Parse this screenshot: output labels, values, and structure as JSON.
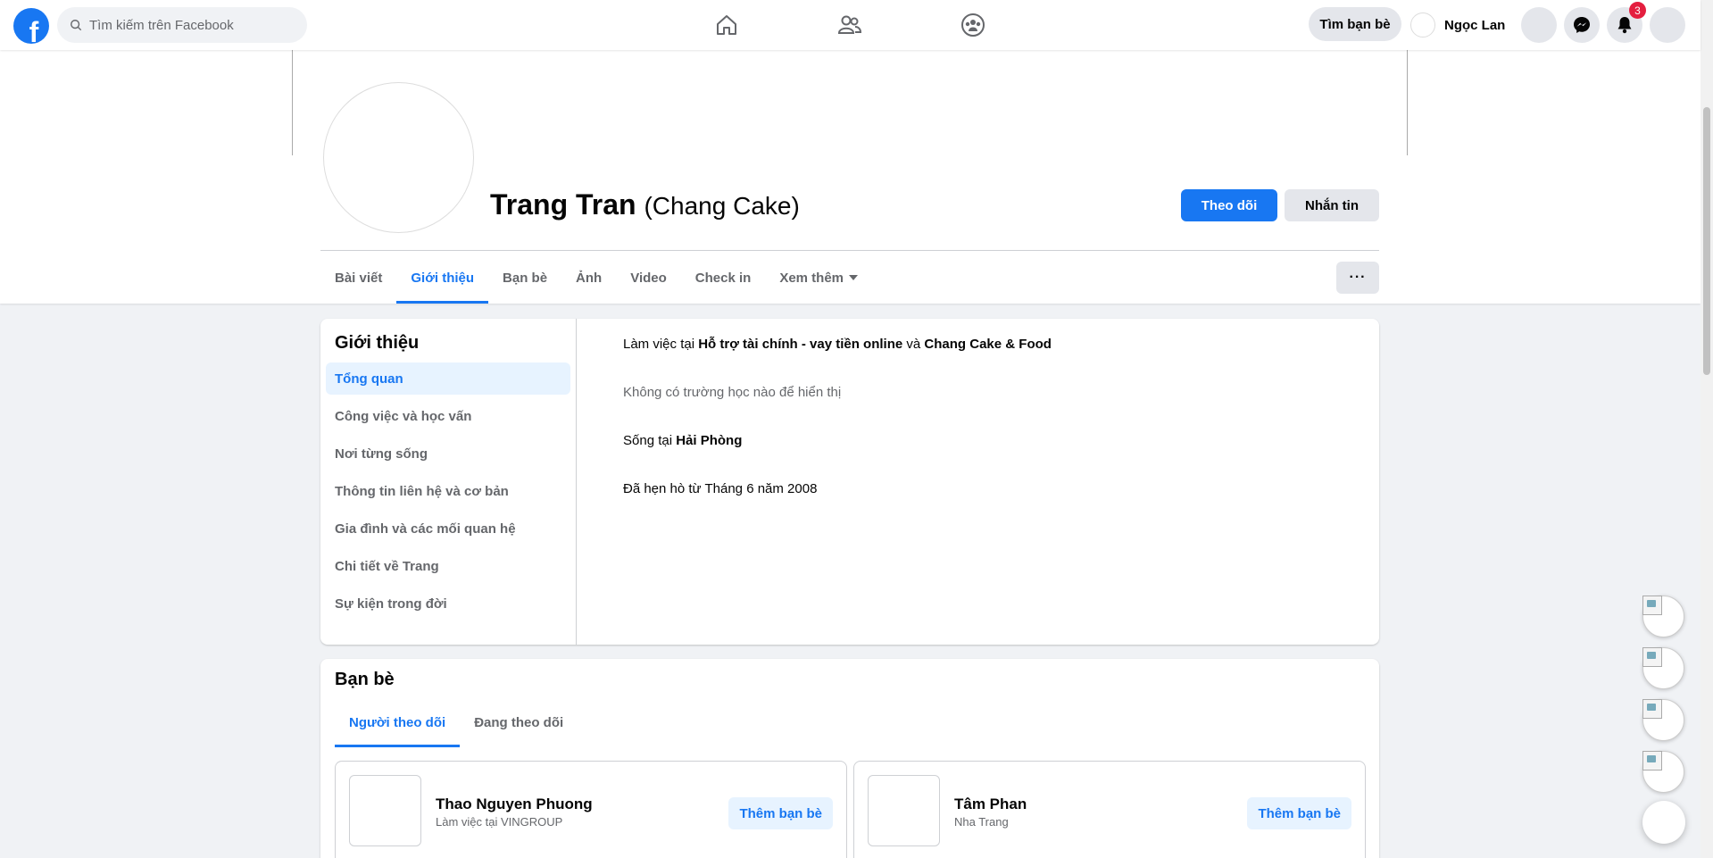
{
  "topbar": {
    "logo": "f",
    "search_placeholder": "Tìm kiếm trên Facebook",
    "find_friends": "Tìm bạn bè",
    "user_name": "Ngọc Lan",
    "notification_count": "3"
  },
  "profile": {
    "name": "Trang Tran",
    "alternate_name": "(Chang Cake)",
    "follow_button": "Theo dõi",
    "message_button": "Nhắn tin",
    "more_button": "···"
  },
  "tabs": [
    {
      "label": "Bài viết"
    },
    {
      "label": "Giới thiệu"
    },
    {
      "label": "Bạn bè"
    },
    {
      "label": "Ảnh"
    },
    {
      "label": "Video"
    },
    {
      "label": "Check in"
    },
    {
      "label": "Xem thêm"
    }
  ],
  "about": {
    "title": "Giới thiệu",
    "menu": [
      {
        "label": "Tổng quan"
      },
      {
        "label": "Công việc và học vấn"
      },
      {
        "label": "Nơi từng sống"
      },
      {
        "label": "Thông tin liên hệ và cơ bản"
      },
      {
        "label": "Gia đình và các mối quan hệ"
      },
      {
        "label": "Chi tiết về Trang"
      },
      {
        "label": "Sự kiện trong đời"
      }
    ],
    "work_prefix": "Làm việc tại ",
    "work_1": "Hỗ trợ tài chính - vay tiền online",
    "work_conj": " và ",
    "work_2": "Chang Cake & Food",
    "education": "Không có trường học nào để hiển thị",
    "lives_prefix": "Sống tại ",
    "lives_place": "Hải Phòng",
    "relationship": "Đã hẹn hò từ Tháng 6 năm 2008"
  },
  "friends": {
    "title": "Bạn bè",
    "tabs": [
      {
        "label": "Người theo dõi"
      },
      {
        "label": "Đang theo dõi"
      }
    ],
    "items": [
      {
        "name": "Thao Nguyen Phuong",
        "subtitle": "Làm việc tại VINGROUP",
        "action": "Thêm bạn bè"
      },
      {
        "name": "Tâm Phan",
        "subtitle": "Nha Trang",
        "action": "Thêm bạn bè"
      }
    ]
  },
  "colors": {
    "brand": "#1877f2",
    "badge": "#e41e3f",
    "background": "#f0f2f5"
  }
}
